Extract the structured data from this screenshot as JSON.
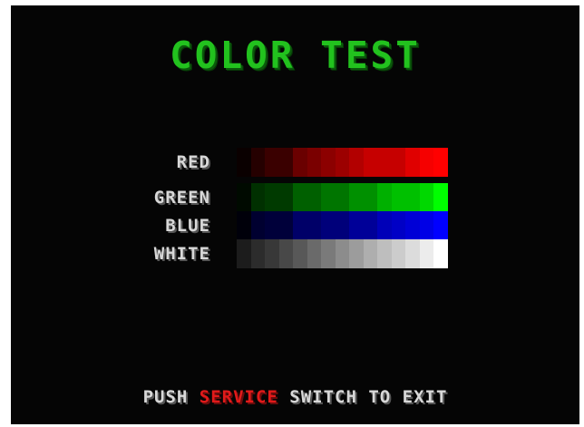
{
  "title": "COLOR TEST",
  "rows": [
    {
      "label": "RED",
      "colors": [
        "#0a0000",
        "#250000",
        "#3a0000",
        "#3a0000",
        "#6a0000",
        "#7a0000",
        "#8c0000",
        "#9c0000",
        "#b20000",
        "#c60000",
        "#c60000",
        "#c60000",
        "#e00000",
        "#f60000",
        "#ff0000"
      ]
    },
    {
      "label": "GREEN",
      "colors": [
        "#000a00",
        "#003000",
        "#003a00",
        "#003a00",
        "#006000",
        "#006000",
        "#007500",
        "#007500",
        "#009000",
        "#009000",
        "#00b000",
        "#00c000",
        "#00c000",
        "#00d800",
        "#00ff00"
      ]
    },
    {
      "label": "BLUE",
      "colors": [
        "#00000a",
        "#000030",
        "#00003a",
        "#00003a",
        "#000068",
        "#000068",
        "#00007a",
        "#00007a",
        "#000098",
        "#000098",
        "#0000b8",
        "#0000c6",
        "#0000d6",
        "#0000e6",
        "#0000ff"
      ]
    },
    {
      "label": "WHITE",
      "colors": [
        "#1c1c1c",
        "#2c2c2c",
        "#383838",
        "#484848",
        "#585858",
        "#6a6a6a",
        "#7a7a7a",
        "#8c8c8c",
        "#9c9c9c",
        "#aeaeae",
        "#bebebe",
        "#cccccc",
        "#dcdcdc",
        "#ececec",
        "#ffffff"
      ]
    }
  ],
  "prompt": {
    "before": "PUSH ",
    "highlight": "SERVICE",
    "after": " SWITCH TO EXIT"
  },
  "colors": {
    "background": "#050505",
    "title": "#22c21e",
    "label": "#d8d8d8",
    "highlight": "#e11a1a"
  }
}
